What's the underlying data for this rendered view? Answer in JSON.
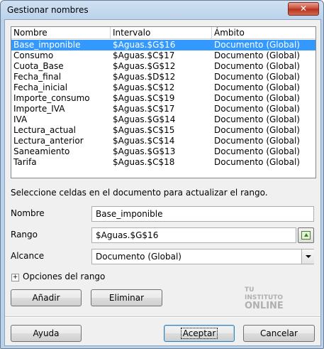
{
  "window": {
    "title": "Gestionar nombres",
    "close_label": "✕"
  },
  "list": {
    "columns": [
      "Nombre",
      "Intervalo",
      "Ámbito"
    ],
    "rows": [
      {
        "name": "Base_imponible",
        "range": "$Aguas.$G$16",
        "scope": "Documento (Global)",
        "selected": true
      },
      {
        "name": "Consumo",
        "range": "$Aguas.$C$17",
        "scope": "Documento (Global)"
      },
      {
        "name": "Cuota_Base",
        "range": "$Aguas.$G$12",
        "scope": "Documento (Global)"
      },
      {
        "name": "Fecha_final",
        "range": "$Aguas.$D$12",
        "scope": "Documento (Global)"
      },
      {
        "name": "Fecha_inicial",
        "range": "$Aguas.$C$12",
        "scope": "Documento (Global)"
      },
      {
        "name": "Importe_consumo",
        "range": "$Aguas.$C$19",
        "scope": "Documento (Global)"
      },
      {
        "name": "Importe_IVA",
        "range": "$Aguas.$C$17",
        "scope": "Documento (Global)"
      },
      {
        "name": "IVA",
        "range": "$Aguas.$G$14",
        "scope": "Documento (Global)"
      },
      {
        "name": "Lectura_actual",
        "range": "$Aguas.$C$15",
        "scope": "Documento (Global)"
      },
      {
        "name": "Lectura_anterior",
        "range": "$Aguas.$C$14",
        "scope": "Documento (Global)"
      },
      {
        "name": "Saneamiento",
        "range": "$Aguas.$G$13",
        "scope": "Documento (Global)"
      },
      {
        "name": "Tarifa",
        "range": "$Aguas.$C$18",
        "scope": "Documento (Global)"
      }
    ]
  },
  "hint": "Seleccione celdas en el documento para actualizar el rango.",
  "form": {
    "name_label": "Nombre",
    "name_value": "Base_imponible",
    "range_label": "Rango",
    "range_value": "$Aguas.$G$16",
    "scope_label": "Alcance",
    "scope_value": "Documento (Global)"
  },
  "options": {
    "expander_symbol": "+",
    "label": "Opciones del rango"
  },
  "buttons": {
    "add": "Añadir",
    "delete": "Eliminar",
    "help": "Ayuda",
    "accept": "Aceptar",
    "cancel": "Cancelar"
  },
  "watermark": {
    "line1": "TU",
    "line2": "INSTITUTO",
    "line3": "ONLINE"
  },
  "colors": {
    "selection": "#3399ff",
    "frame": "#b9d1ea",
    "close": "#c84731"
  }
}
